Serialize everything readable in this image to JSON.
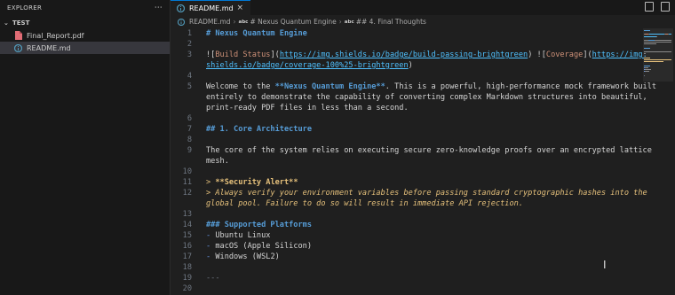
{
  "explorer": {
    "title": "EXPLORER",
    "menu_icon": "ellipsis-icon",
    "folder": "TEST",
    "files": [
      {
        "name": "Final_Report.pdf",
        "icon": "pdf-file-icon",
        "color": "#e06c75"
      },
      {
        "name": "README.md",
        "icon": "markdown-file-icon",
        "color": "#519aba"
      }
    ]
  },
  "tab": {
    "label": "README.md",
    "icon": "info-icon"
  },
  "breadcrumb": [
    "README.md",
    "# Nexus Quantum Engine",
    "## 4. Final Thoughts"
  ],
  "code_lines": [
    {
      "n": "1",
      "segs": [
        {
          "t": "# Nexus Quantum Engine",
          "c": "h"
        }
      ]
    },
    {
      "n": "2",
      "segs": []
    },
    {
      "n": "3",
      "segs": [
        {
          "t": "![",
          "c": "txt"
        },
        {
          "t": "Build Status",
          "c": "lk"
        },
        {
          "t": "](",
          "c": "txt"
        },
        {
          "t": "https://img.shields.io/badge/build-passing-brightgreen",
          "c": "url"
        },
        {
          "t": ") ![",
          "c": "txt"
        },
        {
          "t": "Coverage",
          "c": "lk"
        },
        {
          "t": "](",
          "c": "txt"
        },
        {
          "t": "https://img.",
          "c": "url"
        }
      ]
    },
    {
      "n": "",
      "segs": [
        {
          "t": "shields.io/badge/coverage-100%25-brightgreen",
          "c": "url"
        },
        {
          "t": ")",
          "c": "txt"
        }
      ]
    },
    {
      "n": "4",
      "segs": []
    },
    {
      "n": "5",
      "segs": [
        {
          "t": "Welcome to the ",
          "c": "txt"
        },
        {
          "t": "**Nexus Quantum Engine**",
          "c": "bold"
        },
        {
          "t": ". This is a powerful, high-performance mock framework built",
          "c": "txt"
        }
      ]
    },
    {
      "n": "",
      "segs": [
        {
          "t": "entirely to demonstrate the capability of converting complex Markdown structures into beautiful,",
          "c": "txt"
        }
      ]
    },
    {
      "n": "",
      "segs": [
        {
          "t": "print-ready PDF files in less than a second.",
          "c": "txt"
        }
      ]
    },
    {
      "n": "6",
      "segs": []
    },
    {
      "n": "7",
      "segs": [
        {
          "t": "## 1. Core Architecture",
          "c": "h"
        }
      ]
    },
    {
      "n": "8",
      "segs": []
    },
    {
      "n": "9",
      "segs": [
        {
          "t": "The core of the system relies on executing secure zero-knowledge proofs over an encrypted lattice",
          "c": "txt"
        }
      ]
    },
    {
      "n": "",
      "segs": [
        {
          "t": "mesh.",
          "c": "txt"
        }
      ]
    },
    {
      "n": "10",
      "segs": []
    },
    {
      "n": "11",
      "segs": [
        {
          "t": "> ",
          "c": "qm"
        },
        {
          "t": "**Security Alert**",
          "c": "qb"
        }
      ]
    },
    {
      "n": "12",
      "segs": [
        {
          "t": "> Always verify your environment variables before passing standard cryptographic hashes into the",
          "c": "quote"
        }
      ]
    },
    {
      "n": "",
      "segs": [
        {
          "t": "global pool. Failure to do so will result in immediate API rejection.",
          "c": "quote"
        }
      ]
    },
    {
      "n": "13",
      "segs": []
    },
    {
      "n": "14",
      "segs": [
        {
          "t": "### Supported Platforms",
          "c": "h"
        }
      ]
    },
    {
      "n": "15",
      "segs": [
        {
          "t": "-",
          "c": "li"
        },
        {
          "t": " Ubuntu Linux",
          "c": "txt"
        }
      ]
    },
    {
      "n": "16",
      "segs": [
        {
          "t": "-",
          "c": "li"
        },
        {
          "t": " macOS (Apple Silicon)",
          "c": "txt"
        }
      ]
    },
    {
      "n": "17",
      "segs": [
        {
          "t": "-",
          "c": "li"
        },
        {
          "t": " Windows (WSL2)",
          "c": "txt"
        }
      ]
    },
    {
      "n": "18",
      "segs": []
    },
    {
      "n": "19",
      "segs": [
        {
          "t": "---",
          "c": "hr"
        }
      ]
    },
    {
      "n": "20",
      "segs": []
    }
  ]
}
